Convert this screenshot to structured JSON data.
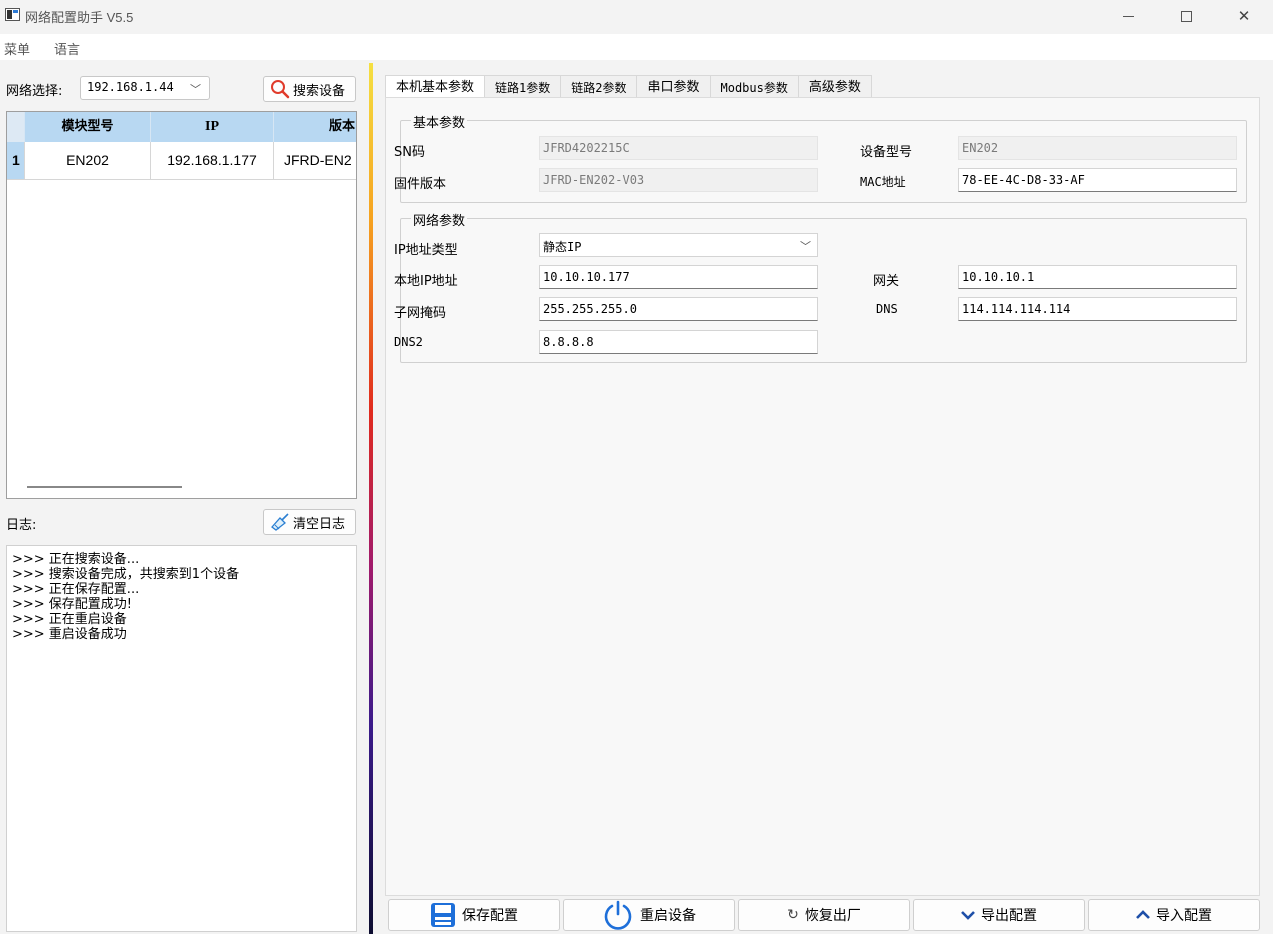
{
  "window": {
    "title": "网络配置助手 V5.5",
    "minimize_glyph": "—",
    "maximize_glyph": "☐",
    "close_glyph": "✕"
  },
  "menu": {
    "items": [
      "菜单",
      "语言"
    ]
  },
  "left": {
    "network_label": "网络选择:",
    "network_value": "192.168.1.44",
    "search_button": "搜索设备",
    "table": {
      "headers": [
        "模块型号",
        "IP",
        "版本"
      ],
      "rows": [
        {
          "index": "1",
          "model": "EN202",
          "ip": "192.168.1.177",
          "version": "JFRD-EN2"
        }
      ]
    },
    "log_label": "日志:",
    "clear_button": "清空日志",
    "log_lines": [
      ">>> 正在搜索设备...",
      ">>> 搜索设备完成，共搜索到1个设备",
      ">>> 正在保存配置...",
      ">>> 保存配置成功!",
      ">>> 正在重启设备",
      ">>> 重启设备成功"
    ]
  },
  "tabs": [
    "本机基本参数",
    "链路1参数",
    "链路2参数",
    "串口参数",
    "Modbus参数",
    "高级参数"
  ],
  "basic": {
    "title": "基本参数",
    "sn_label": "SN码",
    "sn_value": "JFRD4202215C",
    "model_label": "设备型号",
    "model_value": "EN202",
    "firmware_label": "固件版本",
    "firmware_value": "JFRD-EN202-V03",
    "mac_label": "MAC地址",
    "mac_value": "78-EE-4C-D8-33-AF"
  },
  "network": {
    "title": "网络参数",
    "ip_type_label": "IP地址类型",
    "ip_type_value": "静态IP",
    "local_ip_label": "本地IP地址",
    "local_ip_value": "10.10.10.177",
    "gateway_label": "网关",
    "gateway_value": "10.10.10.1",
    "subnet_label": "子网掩码",
    "subnet_value": "255.255.255.0",
    "dns_label": "DNS",
    "dns_value": "114.114.114.114",
    "dns2_label": "DNS2",
    "dns2_value": "8.8.8.8"
  },
  "actions": {
    "save": "保存配置",
    "restart": "重启设备",
    "factory": "恢复出厂",
    "export": "导出配置",
    "import": "导入配置"
  },
  "colors": {
    "header_blue": "#b8d8f2",
    "save_icon_blue": "#1e6fd9",
    "restart_icon_blue": "#1e6fd9"
  }
}
